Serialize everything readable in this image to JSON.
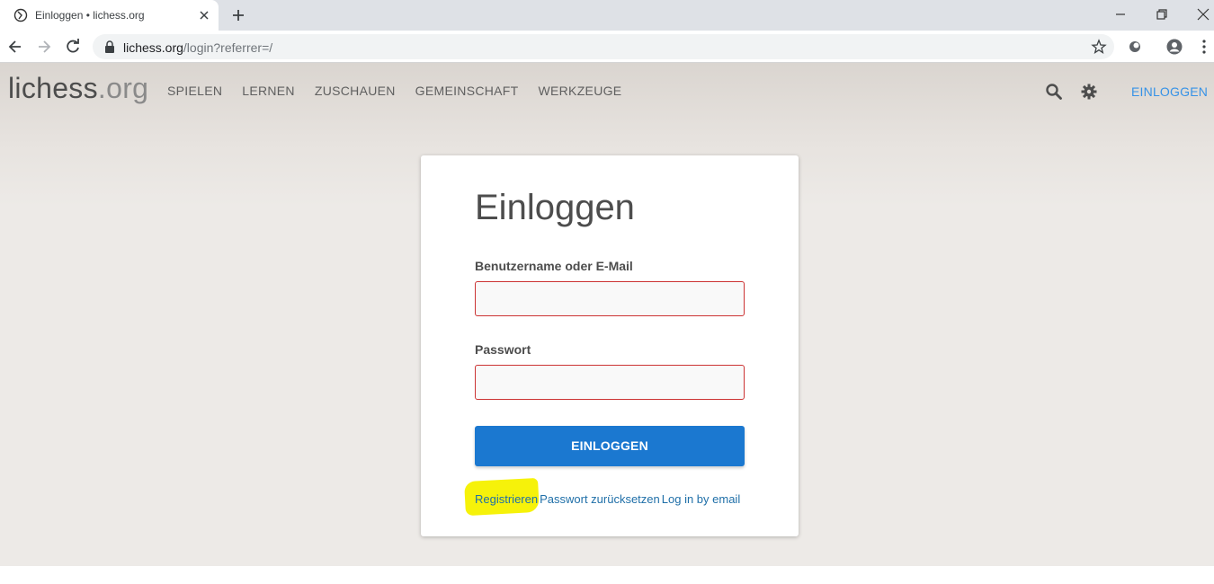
{
  "browser": {
    "tab_title": "Einloggen • lichess.org",
    "url_host": "lichess.org",
    "url_path": "/login?referrer=/"
  },
  "site": {
    "logo_main": "lichess",
    "logo_tld": ".org",
    "nav": [
      "SPIELEN",
      "LERNEN",
      "ZUSCHAUEN",
      "GEMEINSCHAFT",
      "WERKZEUGE"
    ],
    "login_link": "EINLOGGEN"
  },
  "form": {
    "title": "Einloggen",
    "username_label": "Benutzername oder E-Mail",
    "username_value": "",
    "password_label": "Passwort",
    "password_value": "",
    "submit_label": "EINLOGGEN",
    "links": {
      "register": "Registrieren",
      "reset": "Passwort zurücksetzen",
      "email_login": "Log in by email"
    }
  },
  "colors": {
    "accent": "#1b78d0",
    "link": "#1f6fa8",
    "header_link": "#3692e7",
    "input_error_border": "#cc3333",
    "highlight": "#f6f20a"
  }
}
